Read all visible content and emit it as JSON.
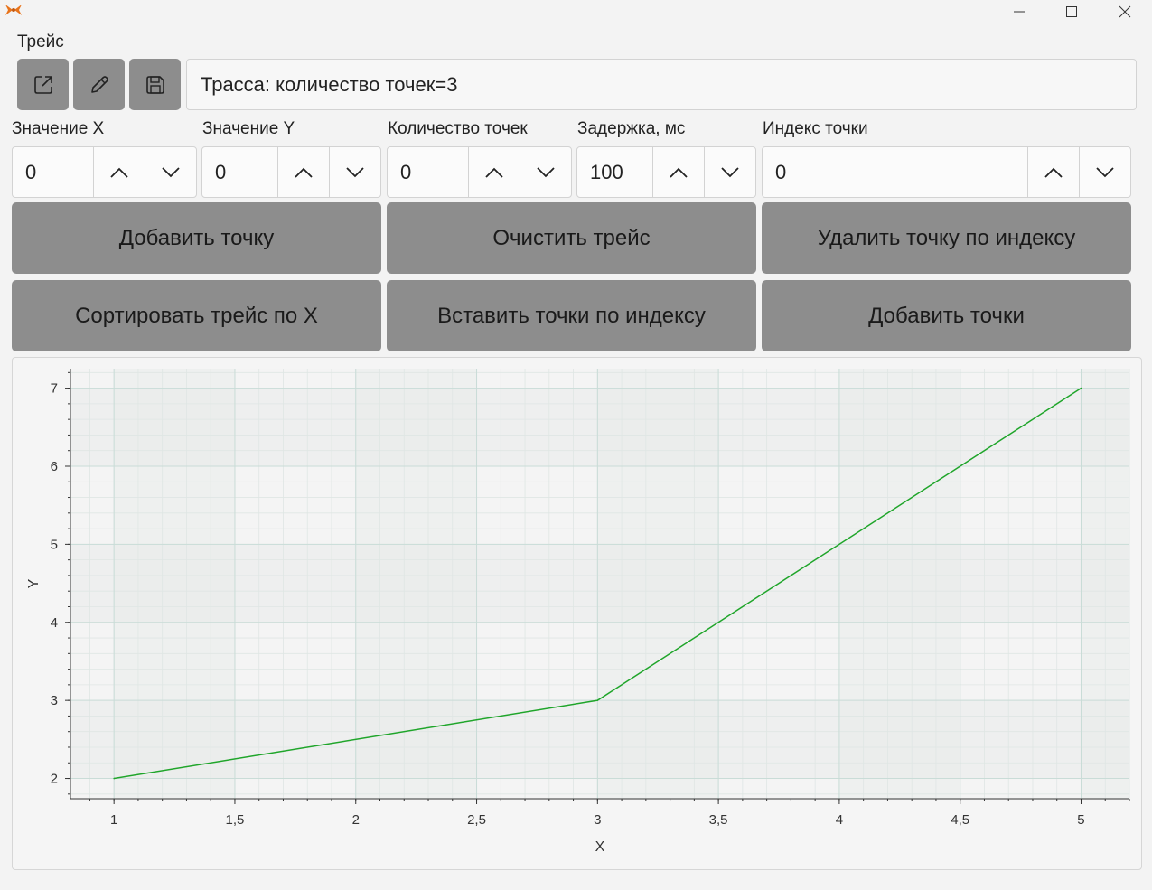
{
  "window": {
    "title_menu": "Трейс",
    "accent": "#e8731a"
  },
  "toolbar": {
    "buttons": [
      {
        "icon": "external-link-icon"
      },
      {
        "icon": "pencil-icon"
      },
      {
        "icon": "save-icon"
      }
    ],
    "trace_info": "Трасса: количество точек=3"
  },
  "fields": [
    {
      "label": "Значение X",
      "value": "0"
    },
    {
      "label": "Значение Y",
      "value": "0"
    },
    {
      "label": "Количество точек",
      "value": "0"
    },
    {
      "label": "Задержка, мс",
      "value": "100"
    },
    {
      "label": "Индекс точки",
      "value": "0"
    }
  ],
  "actions": {
    "add_point": "Добавить точку",
    "clear_trace": "Очистить трейс",
    "delete_by_index": "Удалить точку по индексу",
    "sort_by_x": "Сортировать трейс по X",
    "insert_by_index": "Вставить точки по индексу",
    "add_points": "Добавить точки"
  },
  "chart_data": {
    "type": "line",
    "x": [
      1,
      3,
      5
    ],
    "y": [
      2,
      3,
      7
    ],
    "xlabel": "X",
    "ylabel": "Y",
    "xlim": [
      0.82,
      5.2
    ],
    "ylim": [
      1.74,
      7.25
    ],
    "xticks": [
      "1",
      "1,5",
      "2",
      "2,5",
      "3",
      "3,5",
      "4",
      "4,5",
      "5"
    ],
    "xtick_values": [
      1,
      1.5,
      2,
      2.5,
      3,
      3.5,
      4,
      4.5,
      5
    ],
    "yticks": [
      "2",
      "3",
      "4",
      "5",
      "6",
      "7"
    ],
    "ytick_values": [
      2,
      3,
      4,
      5,
      6,
      7
    ],
    "grid": true,
    "line_color": "#1fa52a"
  }
}
